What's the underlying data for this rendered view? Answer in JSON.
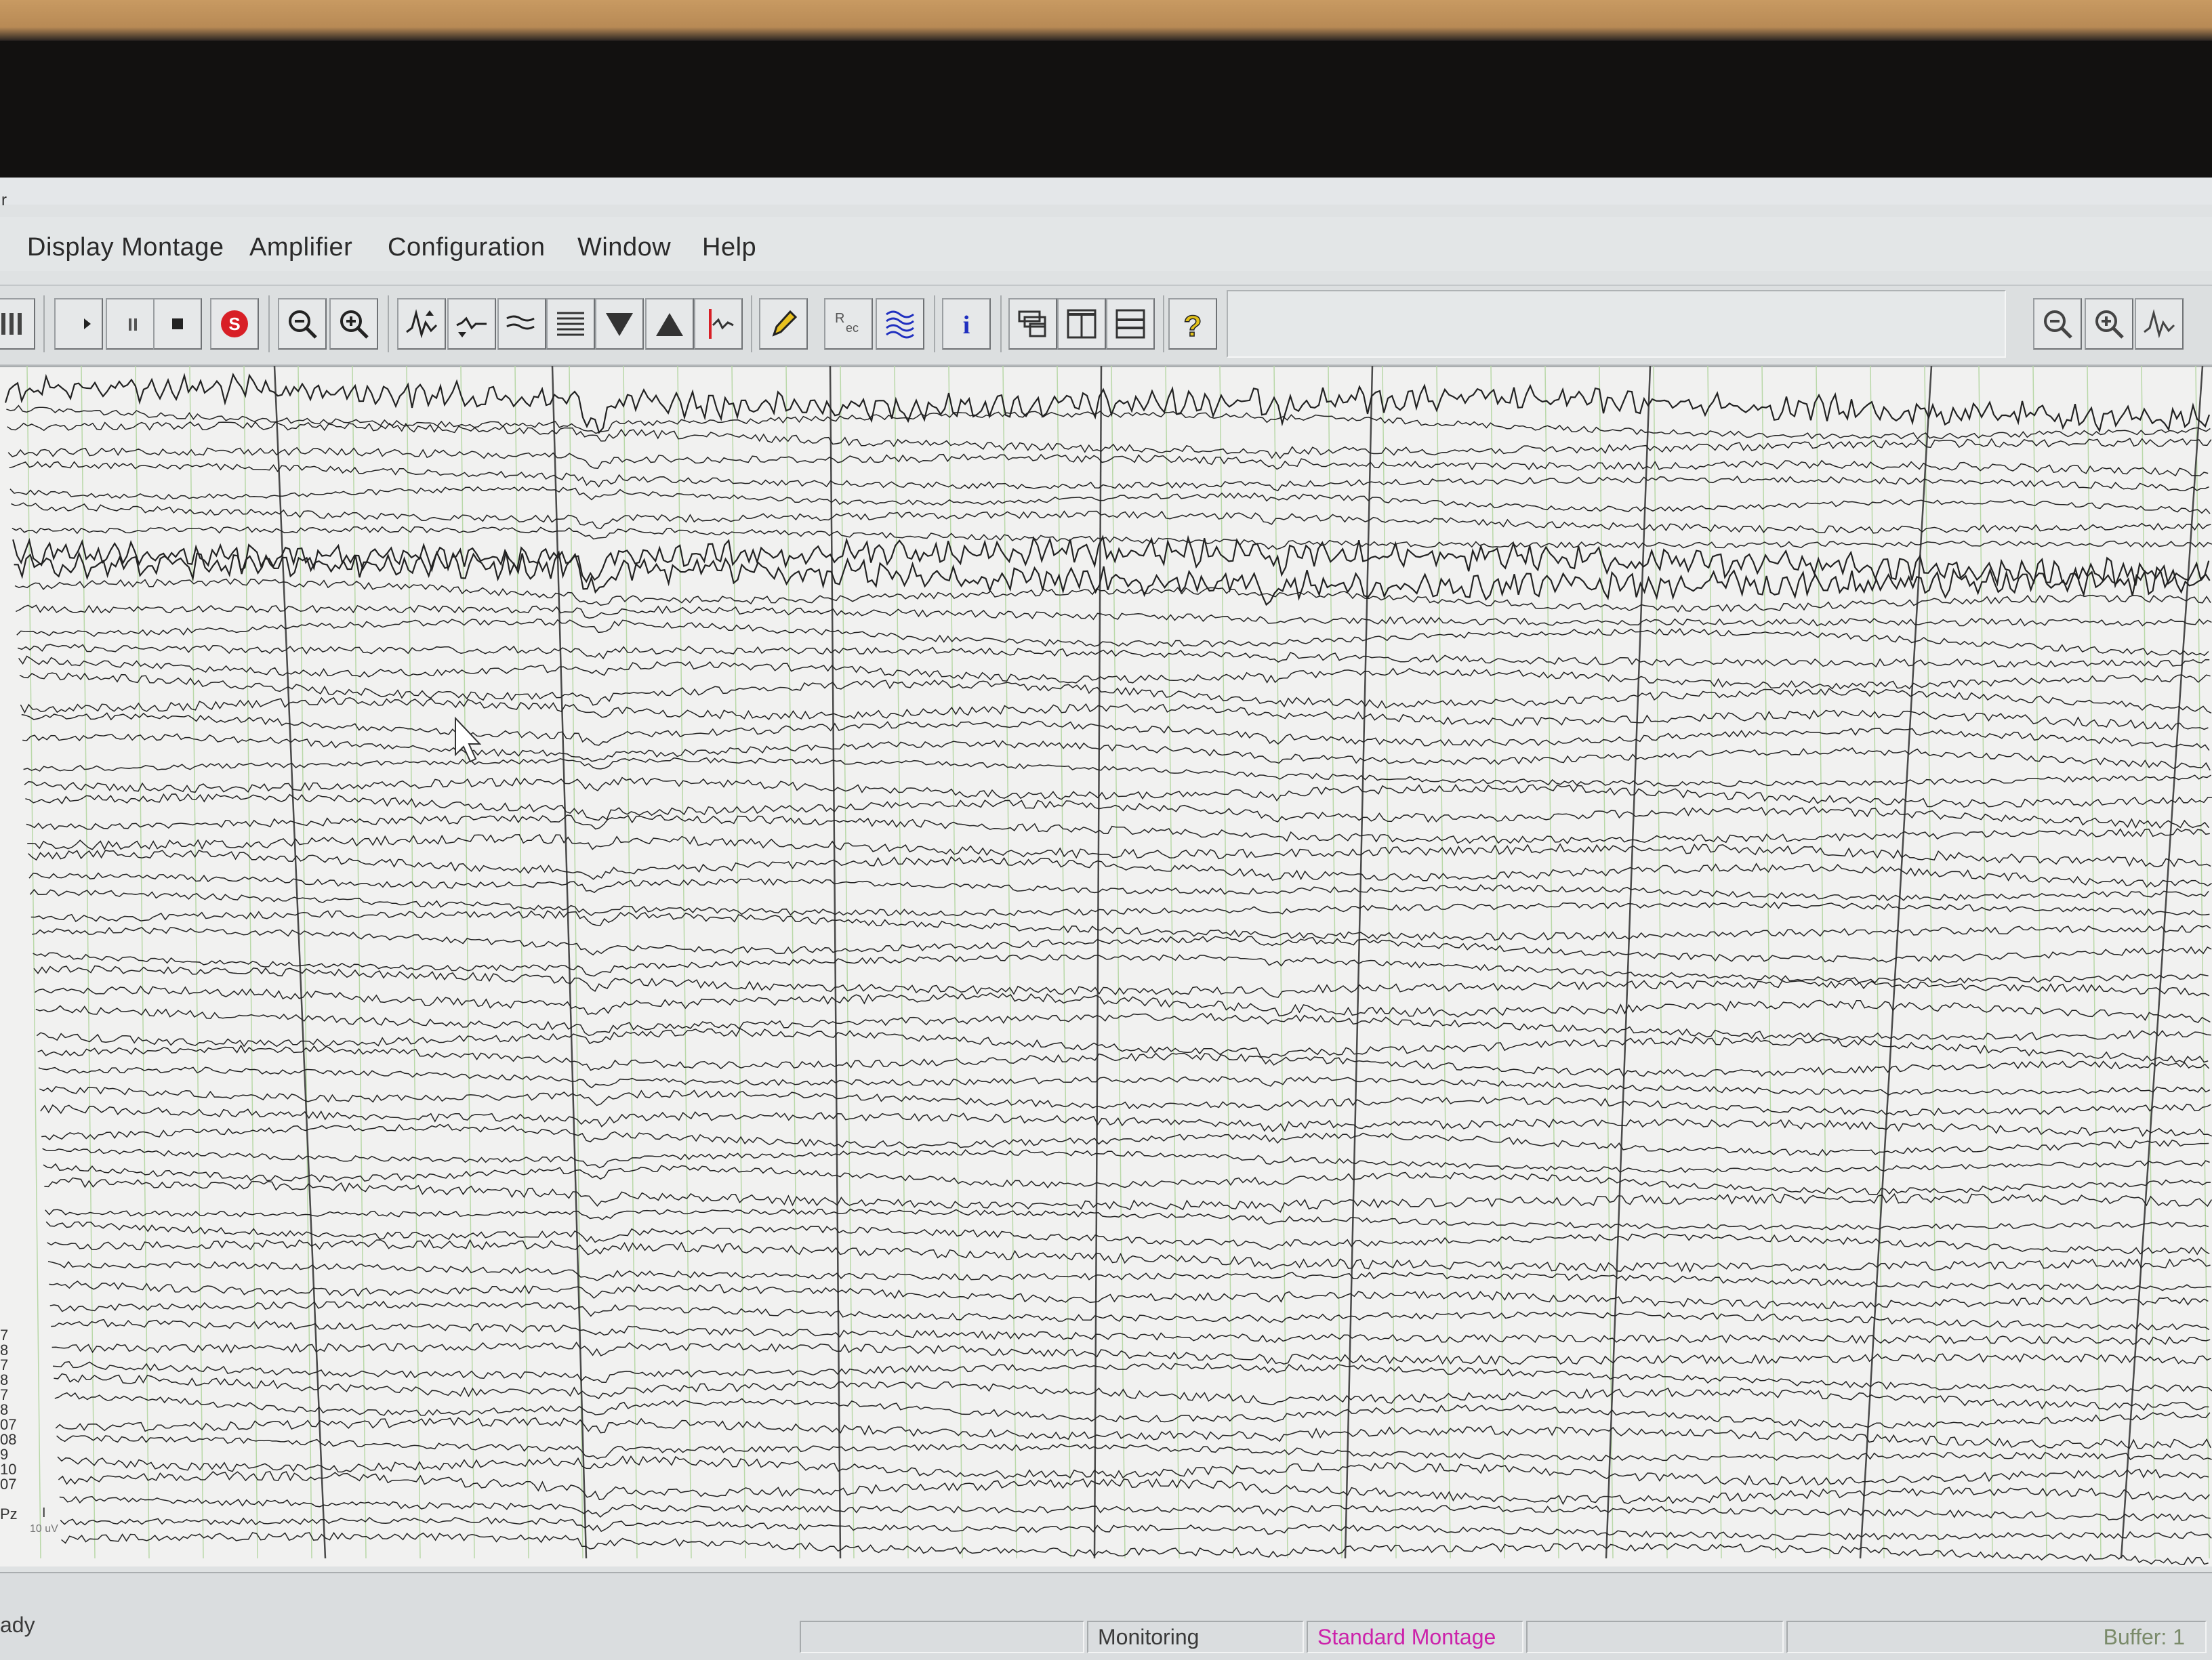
{
  "window": {
    "title_fragment": "r"
  },
  "menu": {
    "items": [
      {
        "label": "Display Montage"
      },
      {
        "label": "Amplifier"
      },
      {
        "label": "Configuration"
      },
      {
        "label": "Window"
      },
      {
        "label": "Help"
      }
    ]
  },
  "toolbar": {
    "buttons": [
      {
        "icon": "split-view-icon"
      },
      {
        "icon": "play-icon"
      },
      {
        "icon": "pause-icon"
      },
      {
        "icon": "stop-icon"
      },
      {
        "icon": "record-icon",
        "color": "#d81f26"
      },
      {
        "icon": "zoom-out-icon"
      },
      {
        "icon": "zoom-in-icon"
      },
      {
        "icon": "increase-sensitivity-icon"
      },
      {
        "icon": "decrease-sensitivity-icon"
      },
      {
        "icon": "filter-icon"
      },
      {
        "icon": "montage-list-icon"
      },
      {
        "icon": "scroll-down-icon"
      },
      {
        "icon": "scroll-up-icon"
      },
      {
        "icon": "event-marker-icon",
        "color": "#d81f26"
      },
      {
        "icon": "pencil-annotate-icon"
      },
      {
        "icon": "impedance-icon"
      },
      {
        "icon": "waveform-overlay-icon"
      },
      {
        "icon": "info-icon",
        "color": "#1f2fbf"
      },
      {
        "icon": "layout-stack-icon"
      },
      {
        "icon": "layout-columns-icon"
      },
      {
        "icon": "layout-rows-icon"
      },
      {
        "icon": "help-icon",
        "color": "#e3c21a"
      }
    ],
    "right_buttons": [
      {
        "icon": "zoom-out-icon"
      },
      {
        "icon": "zoom-in-icon"
      },
      {
        "icon": "increase-sensitivity-icon"
      }
    ]
  },
  "eeg": {
    "channel_labels": [
      "7",
      "8",
      "7",
      "8",
      "7",
      "8",
      "07",
      "08",
      "9",
      "10",
      "07",
      "Pz"
    ],
    "scale_label": "10 uV",
    "scale_marker": "I",
    "trace_color": "#222222",
    "grid_color": "#4a4a4a",
    "minor_grid_color": "#b9d8a8"
  },
  "statusbar": {
    "left_text": "ady",
    "panels": [
      {
        "text": ""
      },
      {
        "text": "Monitoring"
      },
      {
        "text": "Standard Montage",
        "color": "#cc22aa"
      },
      {
        "text": ""
      },
      {
        "text": "Buffer: 1"
      }
    ]
  }
}
